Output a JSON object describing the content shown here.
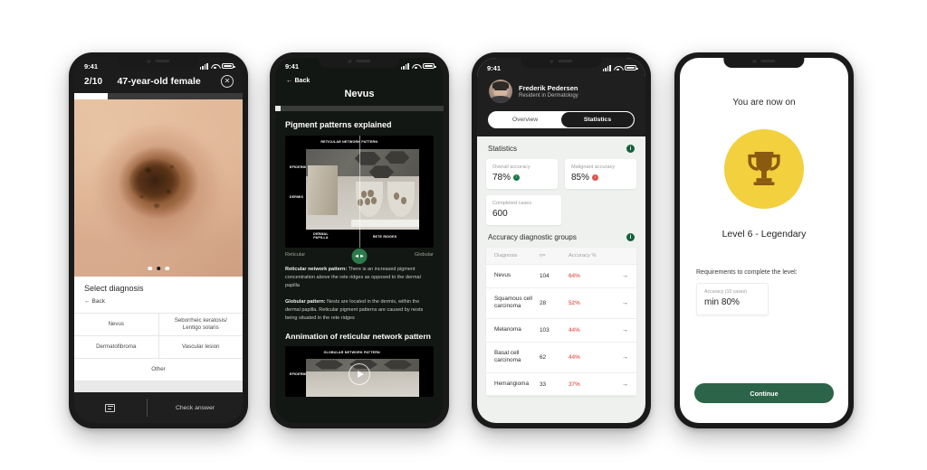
{
  "phone1": {
    "status": {
      "time": "9:41"
    },
    "topbar": {
      "count": "2/10",
      "title": "47-year-old female",
      "close": "✕"
    },
    "progress_percent": 20,
    "dots": 3,
    "active_dot": 2,
    "sheet": {
      "title": "Select diagnosis",
      "back": "Back",
      "options": [
        [
          "Nevus",
          "Seborrheic keratosis/\nLentigo solaris"
        ],
        [
          "Dermatofibroma",
          "Vascular lesion"
        ],
        [
          "Other"
        ]
      ]
    },
    "bottom": {
      "book_icon": "book-icon",
      "check_label": "Check answer"
    }
  },
  "phone2": {
    "status": {
      "time": "9:41"
    },
    "back": "Back",
    "title": "Nevus",
    "progress_percent": 3,
    "heading1": "Pigment patterns explained",
    "figure1": {
      "top_label": "RETICULAR NETWORK PATTERN",
      "left_labels": [
        "EPIDERMIS",
        "DERMIS"
      ],
      "bottom_labels": [
        "DERMAL\nPAPILLA",
        "RETE RIDGES"
      ]
    },
    "caption_left": "Reticular",
    "caption_right": "Globular",
    "slider_icon": "◄►",
    "paragraph1_bold": "Reticular network pattern:",
    "paragraph1_text": " There is an increased pigment concentration above the rete ridges as opposed to the dermal papilla",
    "paragraph2_bold": "Globular pattern:",
    "paragraph2_text": " Nests are located in the dermis, within the dermal papilla. Reticular pigment patterns are caused by nests being situated in the rete ridges",
    "heading2": "Annimation of reticular network pattern",
    "figure2": {
      "top_label": "GLOBULAR NETWORK PATTERN",
      "left_label": "EPIDERMIS"
    }
  },
  "phone3": {
    "status": {
      "time": "9:41"
    },
    "user": {
      "name": "Frederik Pedersen",
      "role": "Resident in Dermatology",
      "avatar": "user-avatar"
    },
    "segments": [
      {
        "label": "Overview",
        "active": false
      },
      {
        "label": "Statistics",
        "active": true
      }
    ],
    "statistics_title": "Statistics",
    "info_icon": "i",
    "cards": [
      {
        "label": "Overall accuracy",
        "value": "78%",
        "trend": "up"
      },
      {
        "label": "Malignant accuracy",
        "value": "85%",
        "trend": "down"
      },
      {
        "label": "Completed cases",
        "value": "600",
        "trend": "none"
      }
    ],
    "groups_title": "Accuracy diagnostic groups",
    "table": {
      "headers": [
        "Diagnosis",
        "n=",
        "Accuracy %"
      ],
      "rows": [
        {
          "diagnosis": "Nevus",
          "n": "104",
          "accuracy": "64%"
        },
        {
          "diagnosis": "Squamous cell carcinoma",
          "n": "28",
          "accuracy": "52%"
        },
        {
          "diagnosis": "Melanoma",
          "n": "103",
          "accuracy": "44%"
        },
        {
          "diagnosis": "Basal cell carcinoma",
          "n": "62",
          "accuracy": "44%"
        },
        {
          "diagnosis": "Hemangioma",
          "n": "33",
          "accuracy": "37%"
        }
      ]
    },
    "accuracy_color": "#e8716c",
    "arrow": "→"
  },
  "phone4": {
    "headline": "You are now on",
    "badge_icon": "trophy-icon",
    "badge_color": "#f2d03e",
    "level": "Level 6 - Legendary",
    "requirements_label": "Requirements to complete the level:",
    "requirement_card": {
      "label": "Accuracy (10 cases)",
      "value": "min 80%"
    },
    "continue_label": "Continue",
    "continue_color": "#2b6448"
  }
}
